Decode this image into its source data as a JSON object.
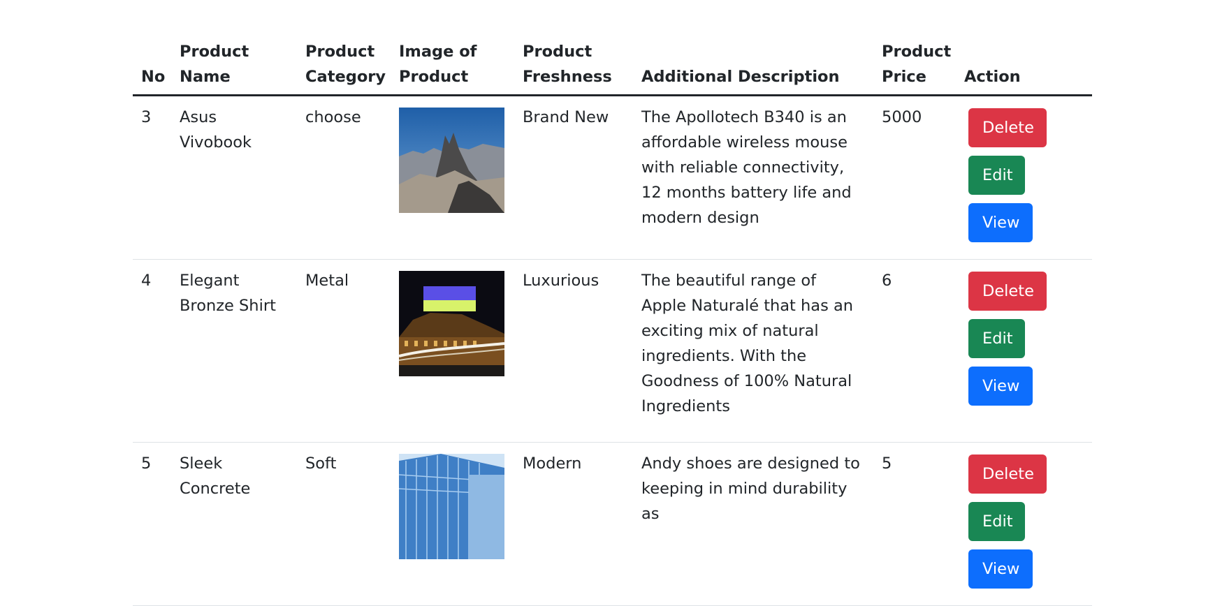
{
  "table": {
    "headers": {
      "no": "No",
      "name": "Product Name",
      "category": "Product Category",
      "image": "Image of Product",
      "freshness": "Product Freshness",
      "description": "Additional Description",
      "price": "Product Price",
      "action": "Action"
    },
    "rows": [
      {
        "no": "3",
        "name": "Asus Vivobook",
        "category": "choose",
        "image_icon": "mountain-photo",
        "freshness": "Brand New",
        "description": "The Apollotech B340 is an affordable wireless mouse with reliable connectivity, 12 months battery life and modern design",
        "price": "5000"
      },
      {
        "no": "4",
        "name": "Elegant Bronze Shirt",
        "category": "Metal",
        "image_icon": "night-building-photo",
        "freshness": "Luxurious",
        "description": "The beautiful range of Apple Naturalé that has an exciting mix of natural ingredients. With the Goodness of 100% Natural Ingredients",
        "price": "6"
      },
      {
        "no": "5",
        "name": "Sleek Concrete",
        "category": "Soft",
        "image_icon": "glass-building-photo",
        "freshness": "Modern",
        "description": "Andy shoes are designed to keeping in mind durability as",
        "price": "5"
      }
    ]
  },
  "actions": {
    "delete_label": "Delete",
    "edit_label": "Edit",
    "view_label": "View"
  },
  "colors": {
    "danger": "#dc3545",
    "success": "#198754",
    "primary": "#0d6efd",
    "text": "#212529"
  }
}
